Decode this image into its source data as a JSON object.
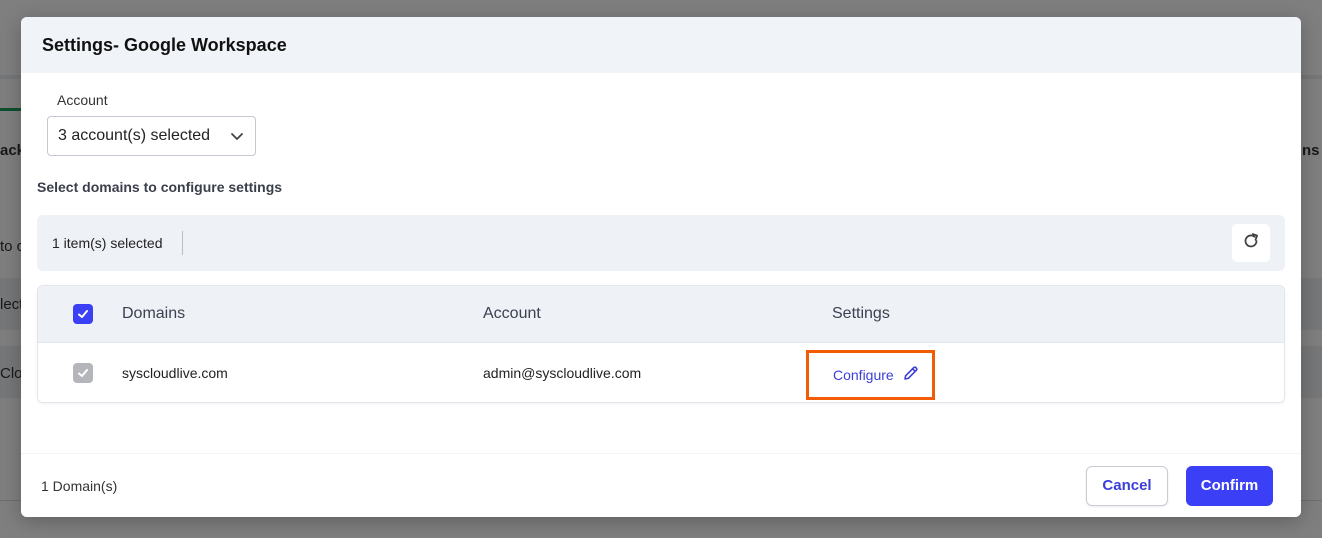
{
  "background": {
    "fragments": [
      "ack",
      "ns",
      "to c",
      "lect",
      "Clo"
    ]
  },
  "modal": {
    "title": "Settings- Google Workspace",
    "account_label": "Account",
    "account_select_value": "3 account(s) selected",
    "section_label": "Select domains to configure settings",
    "selection_text": "1 item(s) selected",
    "table": {
      "columns": [
        "Domains",
        "Account",
        "Settings"
      ],
      "rows": [
        {
          "domain": "syscloudlive.com",
          "account": "admin@syscloudlive.com",
          "settings_link": "Configure"
        }
      ]
    },
    "footer": {
      "count": "1 Domain(s)",
      "cancel_label": "Cancel",
      "confirm_label": "Confirm"
    }
  },
  "colors": {
    "accent": "#3b3ff5",
    "highlight_border": "#f25c05",
    "header_bg": "#f0f3f8"
  },
  "icons": [
    "chevron-down-icon",
    "refresh-icon",
    "checkbox-checked-icon",
    "pencil-icon"
  ]
}
